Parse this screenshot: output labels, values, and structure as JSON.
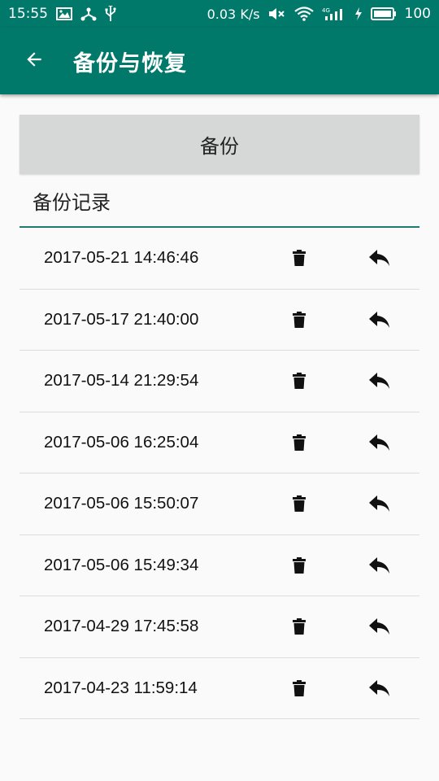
{
  "status_bar": {
    "time": "15:55",
    "net_speed": "0.03 K/s",
    "battery": "100",
    "icons": [
      "image-icon",
      "usb-debug-icon",
      "usb-icon",
      "mute-icon",
      "wifi-icon",
      "4g-signal-icon",
      "charging-icon",
      "battery-icon"
    ]
  },
  "app_bar": {
    "title": "备份与恢复",
    "back_icon": "arrow-back-icon"
  },
  "backup_button": {
    "label": "备份"
  },
  "records": {
    "header": "备份记录",
    "items": [
      {
        "time": "2017-05-21 14:46:46"
      },
      {
        "time": "2017-05-17 21:40:00"
      },
      {
        "time": "2017-05-14 21:29:54"
      },
      {
        "time": "2017-05-06 16:25:04"
      },
      {
        "time": "2017-05-06 15:50:07"
      },
      {
        "time": "2017-05-06 15:49:34"
      },
      {
        "time": "2017-04-29 17:45:58"
      },
      {
        "time": "2017-04-23 11:59:14"
      }
    ],
    "delete_icon": "trash-icon",
    "restore_icon": "reply-icon"
  },
  "colors": {
    "primary": "#00796b",
    "button_bg": "#d6d7d7",
    "background": "#fafafa",
    "divider": "#dddddd"
  }
}
